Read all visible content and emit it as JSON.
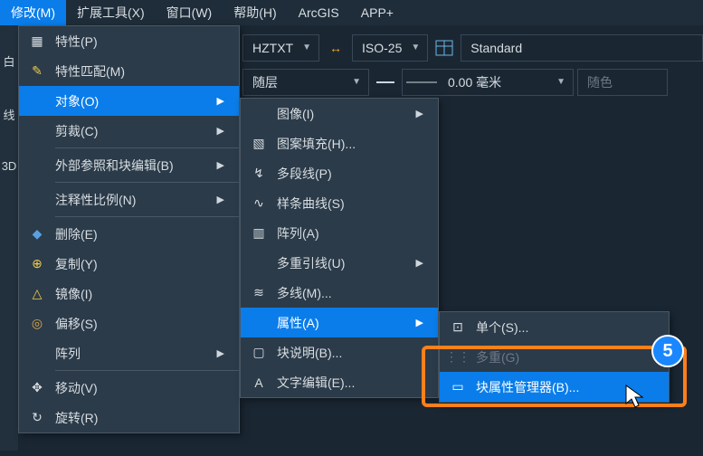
{
  "menubar": {
    "modify": "修改(M)",
    "ext": "扩展工具(X)",
    "window": "窗口(W)",
    "help": "帮助(H)",
    "arcgis": "ArcGIS",
    "app": "APP+"
  },
  "toolbar": {
    "font": "HZTXT",
    "dim": "ISO-25",
    "table": "Standard",
    "layer": "随层",
    "lw": "0.00 毫米",
    "col": "随色"
  },
  "leftstrip": {
    "a": "白",
    "b": "线",
    "c": "3D"
  },
  "menu1": {
    "props": "特性(P)",
    "matchprops": "特性匹配(M)",
    "object": "对象(O)",
    "clip": "剪裁(C)",
    "xref": "外部参照和块编辑(B)",
    "annoscale": "注释性比例(N)",
    "erase": "删除(E)",
    "copy": "复制(Y)",
    "mirror": "镜像(I)",
    "offset": "偏移(S)",
    "array": "阵列",
    "move": "移动(V)",
    "rotate": "旋转(R)"
  },
  "menu2": {
    "image": "图像(I)",
    "hatch": "图案填充(H)...",
    "pline": "多段线(P)",
    "spline": "样条曲线(S)",
    "arr": "阵列(A)",
    "mleader": "多重引线(U)",
    "mline": "多线(M)...",
    "attr": "属性(A)",
    "bdesc": "块说明(B)...",
    "textedit": "文字编辑(E)..."
  },
  "menu3": {
    "single": "单个(S)...",
    "multi": "多重(G)",
    "battman": "块属性管理器(B)..."
  },
  "callout": {
    "num": "5"
  },
  "icons": {
    "props": "▦",
    "brush": "✎",
    "obj": "◧",
    "clip": "✂",
    "xref": "⧉",
    "scale": "A",
    "erase": "◆",
    "copy": "⊕",
    "mirror": "△",
    "offset": "◎",
    "arr": "▤",
    "move": "✥",
    "rotate": "↻",
    "hatch": "▧",
    "pline": "↯",
    "spline": "∿",
    "arr2": "▥",
    "mleader": "↗",
    "mline": "≋",
    "attr": "✎",
    "bdesc": "▢",
    "text": "A",
    "single": "⊡",
    "multi": "⋮⋮",
    "batt": "▭",
    "dimicon": "↔"
  }
}
